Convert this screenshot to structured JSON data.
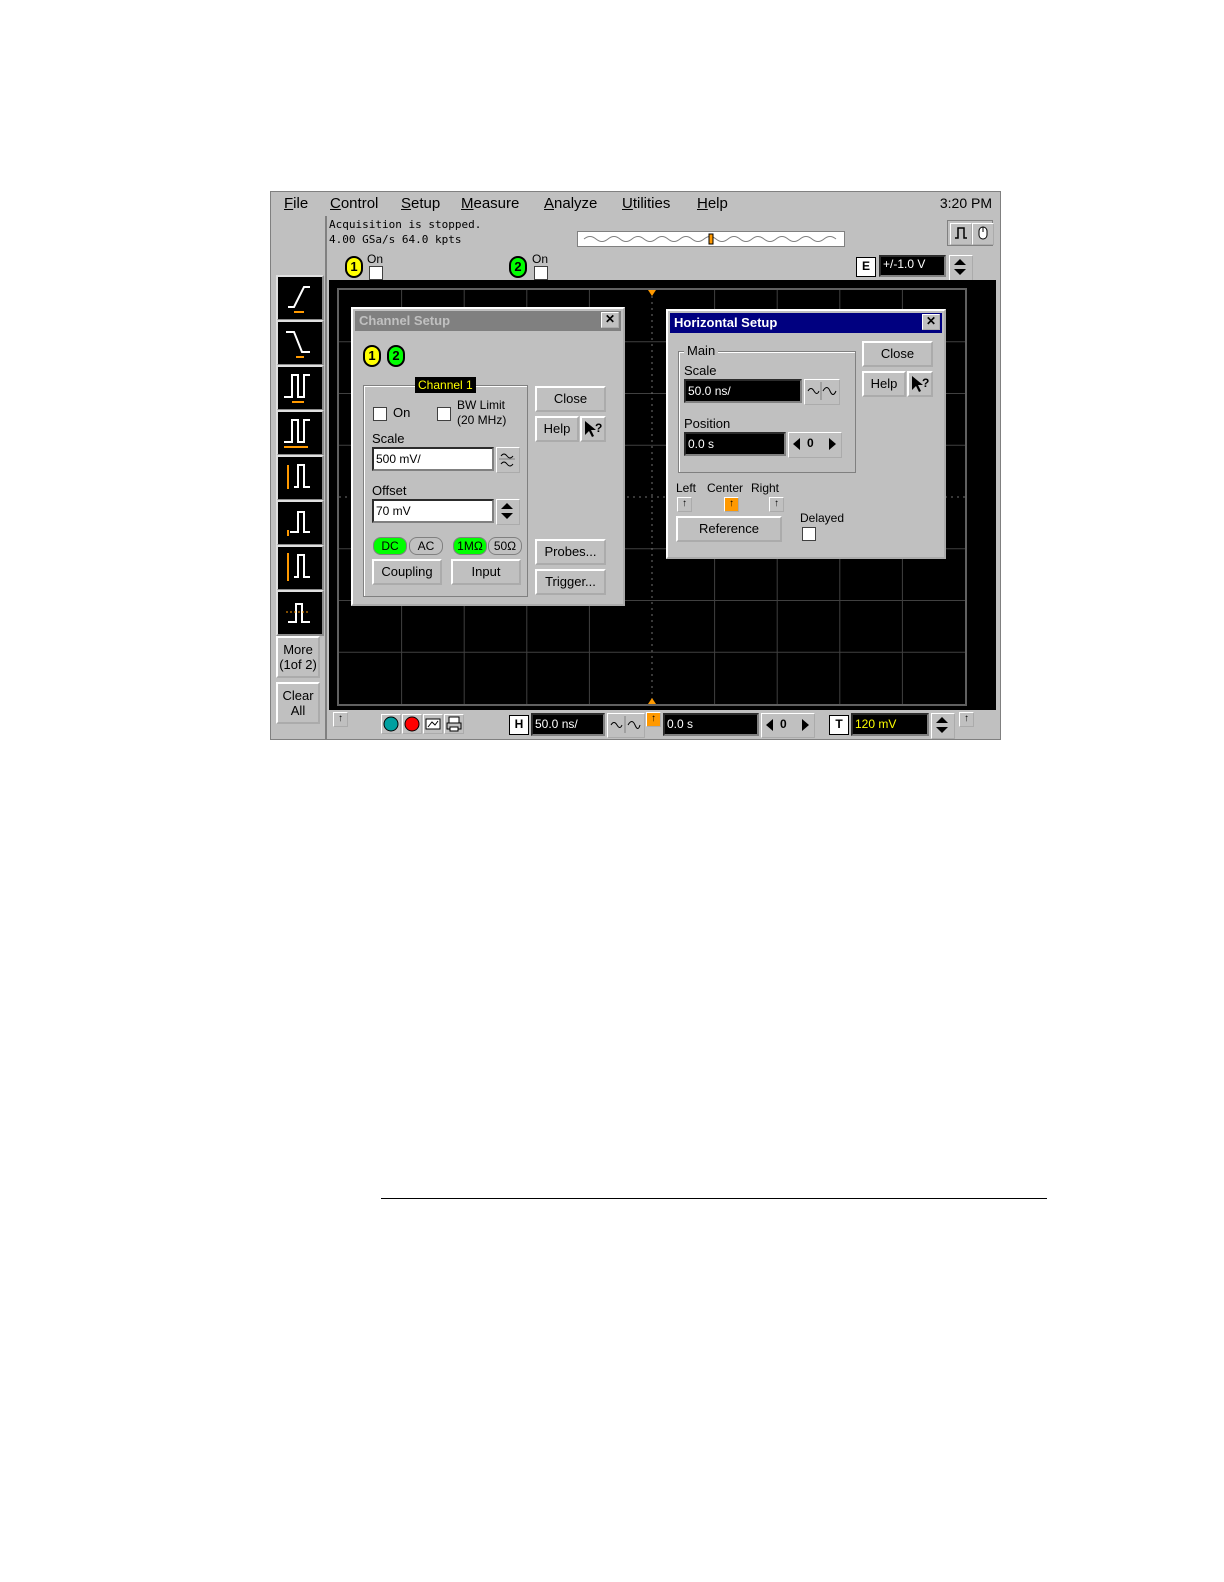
{
  "menu": {
    "items": [
      {
        "label": "File",
        "key": "F",
        "rest": "ile"
      },
      {
        "label": "Control",
        "key": "C",
        "rest": "ontrol"
      },
      {
        "label": "Setup",
        "key": "S",
        "rest": "etup"
      },
      {
        "label": "Measure",
        "key": "M",
        "rest": "easure"
      },
      {
        "label": "Analyze",
        "key": "A",
        "rest": "nalyze"
      },
      {
        "label": "Utilities",
        "key": "U",
        "rest": "tilities"
      },
      {
        "label": "Help",
        "key": "H",
        "rest": "elp"
      }
    ],
    "clock": "3:20 PM"
  },
  "status": {
    "line1": "Acquisition is stopped.",
    "line2": "4.00 GSa/s  64.0 kpts"
  },
  "channels": {
    "ch1": {
      "number": "1",
      "on_label": "On",
      "color": "#ffff00"
    },
    "ch2": {
      "number": "2",
      "on_label": "On",
      "color": "#00ff00"
    }
  },
  "external": {
    "badge": "E",
    "value": "+/-1.0 V"
  },
  "side_buttons": {
    "more": "More",
    "more_sub": "(1of 2)",
    "clear": "Clear",
    "clear_sub": "All"
  },
  "channel_setup": {
    "title": "Channel Setup",
    "group_label": "Channel 1",
    "on_label": "On",
    "bw_limit": "BW Limit",
    "bw_limit_sub": "(20 MHz)",
    "scale_label": "Scale",
    "scale_value": "500 mV/",
    "offset_label": "Offset",
    "offset_value": "70 mV",
    "coupling_dc": "DC",
    "coupling_ac": "AC",
    "imp_1m": "1MΩ",
    "imp_50": "50Ω",
    "coupling_btn": "Coupling",
    "input_btn": "Input",
    "close_btn": "Close",
    "help_btn": "Help",
    "probes_btn": "Probes...",
    "trigger_btn": "Trigger..."
  },
  "horizontal_setup": {
    "title": "Horizontal Setup",
    "group_label": "Main",
    "scale_label": "Scale",
    "scale_value": "50.0 ns/",
    "position_label": "Position",
    "position_value": "0.0 s",
    "zero_btn": "0",
    "close_btn": "Close",
    "help_btn": "Help",
    "ref_left": "Left",
    "ref_center": "Center",
    "ref_right": "Right",
    "reference_btn": "Reference",
    "delayed_label": "Delayed"
  },
  "bottom_bar": {
    "h_badge": "H",
    "h_scale": "50.0 ns/",
    "position": "0.0 s",
    "zero_btn": "0",
    "t_badge": "T",
    "trigger_level": "120 mV"
  },
  "colors": {
    "ch1": "#ffff00",
    "ch2": "#00ff00",
    "accent_orange": "#ff9900",
    "title_active": "#000080",
    "title_inactive": "#808080",
    "graticule": "#303030"
  }
}
